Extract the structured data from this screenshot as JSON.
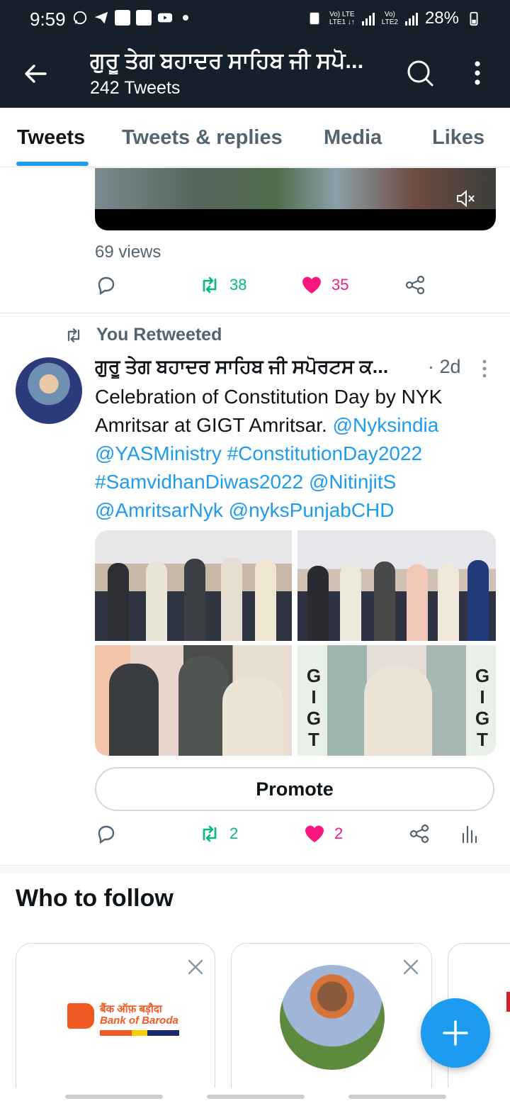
{
  "status_bar": {
    "time": "9:59",
    "network1": "Vo) LTE\nLTE1 ↓↑",
    "network2": "Vo)\nLTE2",
    "battery": "28%"
  },
  "app_bar": {
    "title": "ਗੁਰੂ ਤੇਗ ਬਹਾਦਰ ਸਾਹਿਬ ਜੀ ਸਪੋ...",
    "subtitle": "242 Tweets"
  },
  "tabs": [
    {
      "label": "Tweets",
      "active": true
    },
    {
      "label": "Tweets & replies",
      "active": false
    },
    {
      "label": "Media",
      "active": false
    },
    {
      "label": "Likes",
      "active": false
    }
  ],
  "prev_tweet": {
    "views": "69 views",
    "retweets": "38",
    "likes": "35"
  },
  "tweet": {
    "retweet_label": "You Retweeted",
    "author": "ਗੁਰੂ ਤੇਗ ਬਹਾਦਰ ਸਾਹਿਬ ਜੀ ਸਪੋਰਟਸ ਕ...",
    "time": "· 2d",
    "text_plain": "Celebration of Constitution Day by NYK Amritsar at GIGT Amritsar.",
    "links": [
      "@Nyksindia",
      "@YASMinistry",
      "#ConstitutionDay2022",
      "#SamvidhanDiwas2022",
      "@NitinjitS",
      "@AmritsarNyk",
      "@nyksPunjabCHD"
    ],
    "promote_label": "Promote",
    "retweets": "2",
    "likes": "2",
    "photo4_letters": [
      "G",
      "I",
      "G",
      "T"
    ]
  },
  "who_to_follow": {
    "title": "Who to follow",
    "card1_logo_hi": "बैंक ऑफ़ बड़ौदा",
    "card1_logo_en": "Bank of Baroda"
  },
  "colors": {
    "header_bg": "#15202b",
    "accent": "#1d9bf0",
    "retweet_green": "#00ba7c",
    "like_pink": "#f91880",
    "secondary_text": "#536471"
  }
}
